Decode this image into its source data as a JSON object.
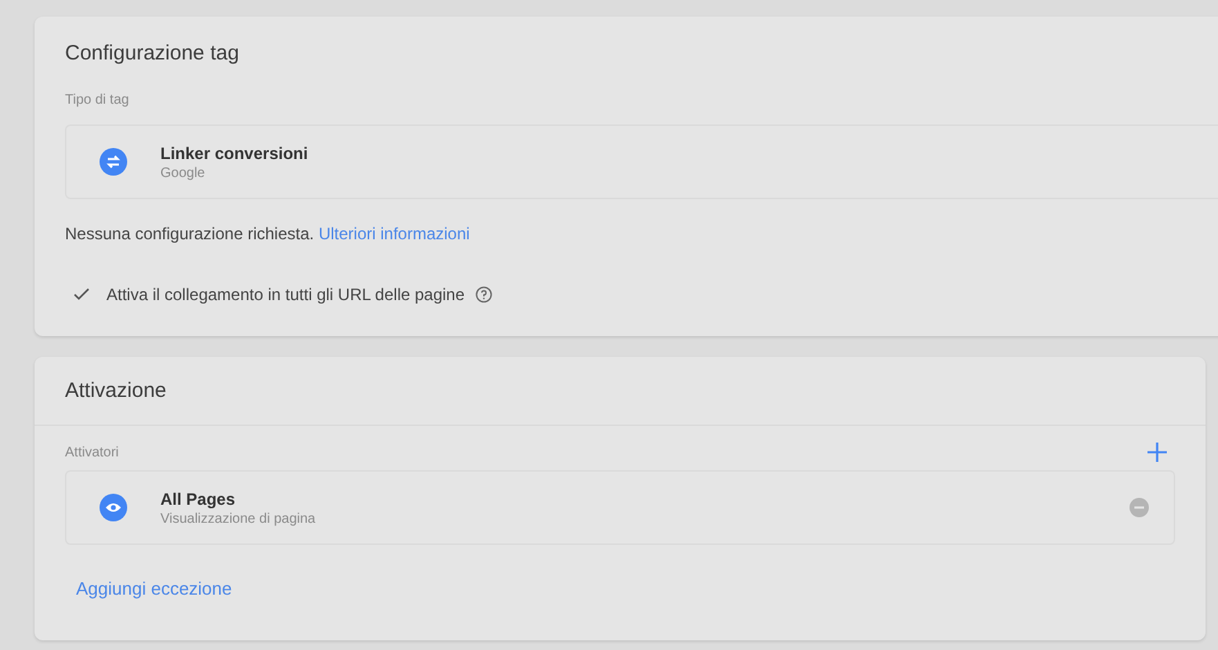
{
  "tag_config": {
    "title": "Configurazione tag",
    "type_label": "Tipo di tag",
    "tag_type": {
      "name": "Linker conversioni",
      "vendor": "Google"
    },
    "note": "Nessuna configurazione richiesta.",
    "note_link": "Ulteriori informazioni",
    "option": {
      "label": "Attiva il collegamento in tutti gli URL delle pagine",
      "checked": true
    }
  },
  "triggering": {
    "title": "Attivazione",
    "triggers_label": "Attivatori",
    "triggers": [
      {
        "name": "All Pages",
        "type": "Visualizzazione di pagina"
      }
    ],
    "add_exception": "Aggiungi eccezione"
  }
}
